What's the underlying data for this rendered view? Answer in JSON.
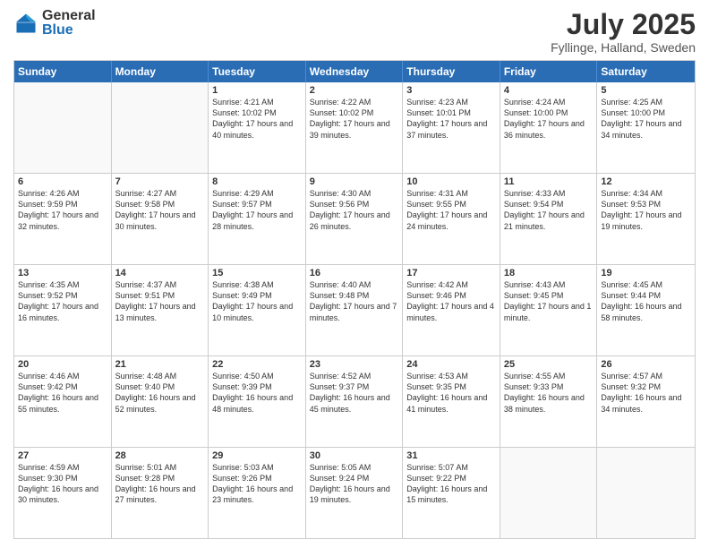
{
  "logo": {
    "general": "General",
    "blue": "Blue"
  },
  "title": "July 2025",
  "subtitle": "Fyllinge, Halland, Sweden",
  "days": [
    "Sunday",
    "Monday",
    "Tuesday",
    "Wednesday",
    "Thursday",
    "Friday",
    "Saturday"
  ],
  "rows": [
    [
      {
        "day": "",
        "info": ""
      },
      {
        "day": "",
        "info": ""
      },
      {
        "day": "1",
        "info": "Sunrise: 4:21 AM\nSunset: 10:02 PM\nDaylight: 17 hours\nand 40 minutes."
      },
      {
        "day": "2",
        "info": "Sunrise: 4:22 AM\nSunset: 10:02 PM\nDaylight: 17 hours\nand 39 minutes."
      },
      {
        "day": "3",
        "info": "Sunrise: 4:23 AM\nSunset: 10:01 PM\nDaylight: 17 hours\nand 37 minutes."
      },
      {
        "day": "4",
        "info": "Sunrise: 4:24 AM\nSunset: 10:00 PM\nDaylight: 17 hours\nand 36 minutes."
      },
      {
        "day": "5",
        "info": "Sunrise: 4:25 AM\nSunset: 10:00 PM\nDaylight: 17 hours\nand 34 minutes."
      }
    ],
    [
      {
        "day": "6",
        "info": "Sunrise: 4:26 AM\nSunset: 9:59 PM\nDaylight: 17 hours\nand 32 minutes."
      },
      {
        "day": "7",
        "info": "Sunrise: 4:27 AM\nSunset: 9:58 PM\nDaylight: 17 hours\nand 30 minutes."
      },
      {
        "day": "8",
        "info": "Sunrise: 4:29 AM\nSunset: 9:57 PM\nDaylight: 17 hours\nand 28 minutes."
      },
      {
        "day": "9",
        "info": "Sunrise: 4:30 AM\nSunset: 9:56 PM\nDaylight: 17 hours\nand 26 minutes."
      },
      {
        "day": "10",
        "info": "Sunrise: 4:31 AM\nSunset: 9:55 PM\nDaylight: 17 hours\nand 24 minutes."
      },
      {
        "day": "11",
        "info": "Sunrise: 4:33 AM\nSunset: 9:54 PM\nDaylight: 17 hours\nand 21 minutes."
      },
      {
        "day": "12",
        "info": "Sunrise: 4:34 AM\nSunset: 9:53 PM\nDaylight: 17 hours\nand 19 minutes."
      }
    ],
    [
      {
        "day": "13",
        "info": "Sunrise: 4:35 AM\nSunset: 9:52 PM\nDaylight: 17 hours\nand 16 minutes."
      },
      {
        "day": "14",
        "info": "Sunrise: 4:37 AM\nSunset: 9:51 PM\nDaylight: 17 hours\nand 13 minutes."
      },
      {
        "day": "15",
        "info": "Sunrise: 4:38 AM\nSunset: 9:49 PM\nDaylight: 17 hours\nand 10 minutes."
      },
      {
        "day": "16",
        "info": "Sunrise: 4:40 AM\nSunset: 9:48 PM\nDaylight: 17 hours\nand 7 minutes."
      },
      {
        "day": "17",
        "info": "Sunrise: 4:42 AM\nSunset: 9:46 PM\nDaylight: 17 hours\nand 4 minutes."
      },
      {
        "day": "18",
        "info": "Sunrise: 4:43 AM\nSunset: 9:45 PM\nDaylight: 17 hours\nand 1 minute."
      },
      {
        "day": "19",
        "info": "Sunrise: 4:45 AM\nSunset: 9:44 PM\nDaylight: 16 hours\nand 58 minutes."
      }
    ],
    [
      {
        "day": "20",
        "info": "Sunrise: 4:46 AM\nSunset: 9:42 PM\nDaylight: 16 hours\nand 55 minutes."
      },
      {
        "day": "21",
        "info": "Sunrise: 4:48 AM\nSunset: 9:40 PM\nDaylight: 16 hours\nand 52 minutes."
      },
      {
        "day": "22",
        "info": "Sunrise: 4:50 AM\nSunset: 9:39 PM\nDaylight: 16 hours\nand 48 minutes."
      },
      {
        "day": "23",
        "info": "Sunrise: 4:52 AM\nSunset: 9:37 PM\nDaylight: 16 hours\nand 45 minutes."
      },
      {
        "day": "24",
        "info": "Sunrise: 4:53 AM\nSunset: 9:35 PM\nDaylight: 16 hours\nand 41 minutes."
      },
      {
        "day": "25",
        "info": "Sunrise: 4:55 AM\nSunset: 9:33 PM\nDaylight: 16 hours\nand 38 minutes."
      },
      {
        "day": "26",
        "info": "Sunrise: 4:57 AM\nSunset: 9:32 PM\nDaylight: 16 hours\nand 34 minutes."
      }
    ],
    [
      {
        "day": "27",
        "info": "Sunrise: 4:59 AM\nSunset: 9:30 PM\nDaylight: 16 hours\nand 30 minutes."
      },
      {
        "day": "28",
        "info": "Sunrise: 5:01 AM\nSunset: 9:28 PM\nDaylight: 16 hours\nand 27 minutes."
      },
      {
        "day": "29",
        "info": "Sunrise: 5:03 AM\nSunset: 9:26 PM\nDaylight: 16 hours\nand 23 minutes."
      },
      {
        "day": "30",
        "info": "Sunrise: 5:05 AM\nSunset: 9:24 PM\nDaylight: 16 hours\nand 19 minutes."
      },
      {
        "day": "31",
        "info": "Sunrise: 5:07 AM\nSunset: 9:22 PM\nDaylight: 16 hours\nand 15 minutes."
      },
      {
        "day": "",
        "info": ""
      },
      {
        "day": "",
        "info": ""
      }
    ]
  ]
}
